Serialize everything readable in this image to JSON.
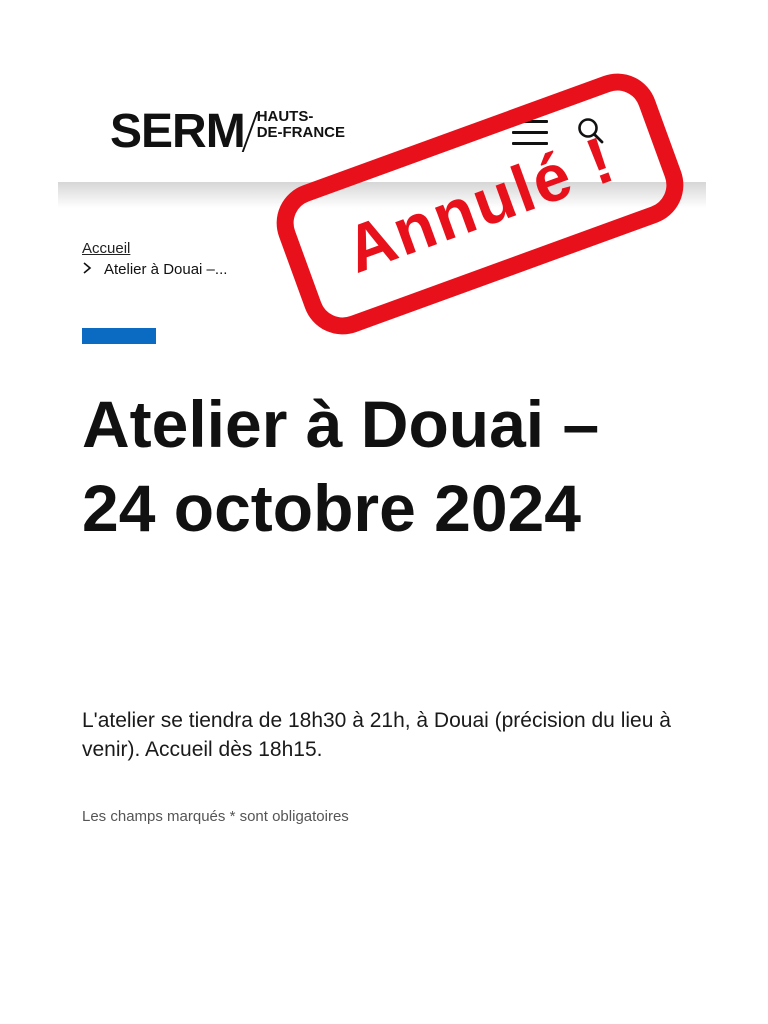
{
  "header": {
    "logo_main": "SERM",
    "logo_region_line1": "HAUTS-",
    "logo_region_line2": "DE-FRANCE",
    "menu_icon": "hamburger-menu-icon",
    "search_icon": "search-icon"
  },
  "breadcrumb": {
    "home_label": "Accueil",
    "current_label": "Atelier à Douai –..."
  },
  "main": {
    "title": "Atelier à Douai – 24 octobre 2024",
    "description": "L'atelier se tiendra de 18h30 à 21h, à Douai (précision du lieu à venir). Accueil dès 18h15.",
    "required_note": "Les champs marqués * sont obligatoires"
  },
  "stamp": {
    "label": "Annulé !"
  },
  "colors": {
    "accent_blue": "#0b6bc2",
    "stamp_red": "#e8111b",
    "text_dark": "#111111"
  }
}
